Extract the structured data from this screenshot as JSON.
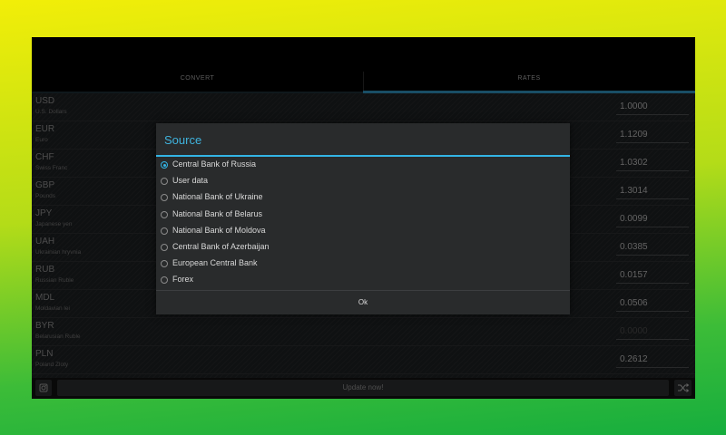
{
  "tabs": {
    "convert": "CONVERT",
    "rates": "RATES"
  },
  "rates": [
    {
      "code": "USD",
      "name": "U.S. Dollars",
      "value": "1.0000",
      "enabled": true
    },
    {
      "code": "EUR",
      "name": "Euro",
      "value": "1.1209",
      "enabled": true
    },
    {
      "code": "CHF",
      "name": "Swiss Franc",
      "value": "1.0302",
      "enabled": true
    },
    {
      "code": "GBP",
      "name": "Pounds",
      "value": "1.3014",
      "enabled": true
    },
    {
      "code": "JPY",
      "name": "Japanese yen",
      "value": "0.0099",
      "enabled": true
    },
    {
      "code": "UAH",
      "name": "Ukrainian hryvnia",
      "value": "0.0385",
      "enabled": true
    },
    {
      "code": "RUB",
      "name": "Russian Ruble",
      "value": "0.0157",
      "enabled": true
    },
    {
      "code": "MDL",
      "name": "Moldavian lei",
      "value": "0.0506",
      "enabled": true
    },
    {
      "code": "BYR",
      "name": "Belarusian Ruble",
      "value": "0.0000",
      "enabled": false
    },
    {
      "code": "PLN",
      "name": "Poland Zloty",
      "value": "0.2612",
      "enabled": true
    }
  ],
  "bottom": {
    "update_label": "Update now!",
    "camera_icon": "camera-icon",
    "shuffle_icon": "shuffle-icon"
  },
  "dialog": {
    "title": "Source",
    "options": [
      {
        "label": "Central Bank of Russia",
        "selected": true
      },
      {
        "label": "User data",
        "selected": false
      },
      {
        "label": "National Bank of Ukraine",
        "selected": false
      },
      {
        "label": "National Bank of Belarus",
        "selected": false
      },
      {
        "label": "National Bank of Moldova",
        "selected": false
      },
      {
        "label": "Central Bank of Azerbaijan",
        "selected": false
      },
      {
        "label": "European Central Bank",
        "selected": false
      },
      {
        "label": "Forex",
        "selected": false
      }
    ],
    "ok_label": "Ok"
  },
  "colors": {
    "accent": "#33b5e5",
    "bg_gradient_top": "#f2ee08",
    "bg_gradient_bottom": "#16ae3e"
  }
}
